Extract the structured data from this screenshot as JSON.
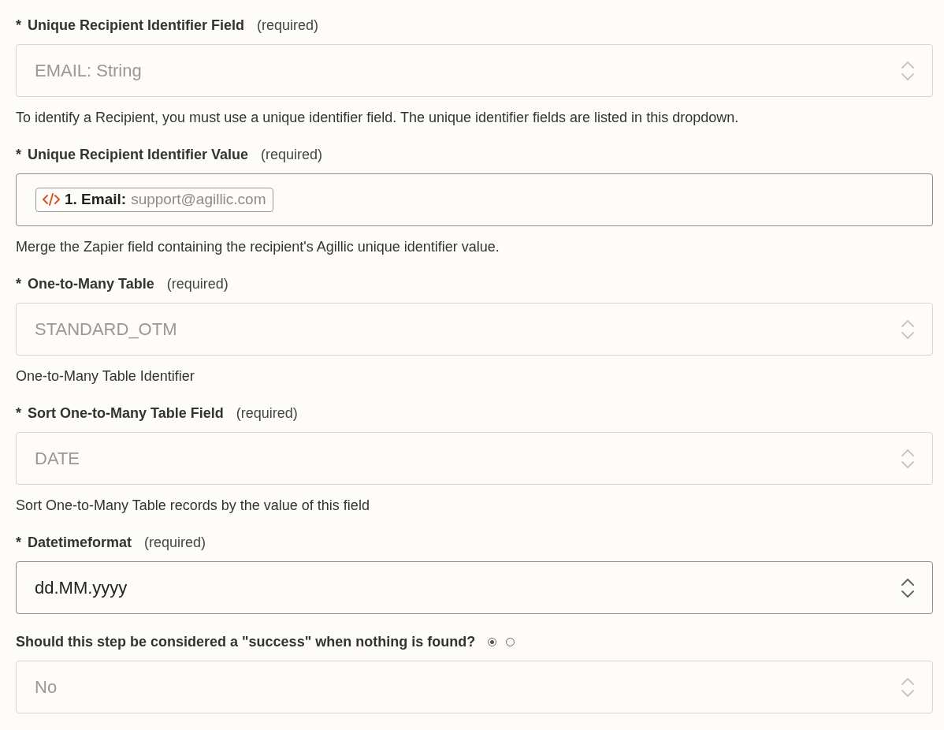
{
  "fields": [
    {
      "kind": "select",
      "asterisk": "*",
      "label": "Unique Recipient Identifier Field",
      "note": "(required)",
      "value": "EMAIL: String",
      "disabled": true,
      "help": "To identify a Recipient, you must use a unique identifier field. The unique identifier fields are listed in this dropdown."
    },
    {
      "kind": "token",
      "asterisk": "*",
      "label": "Unique Recipient Identifier Value",
      "note": "(required)",
      "token_label": "1. Email:",
      "token_value": "support@agillic.com",
      "help": "Merge the Zapier field containing the recipient's Agillic unique identifier value."
    },
    {
      "kind": "select",
      "asterisk": "*",
      "label": "One-to-Many Table",
      "note": "(required)",
      "value": "STANDARD_OTM",
      "disabled": true,
      "help": "One-to-Many Table Identifier"
    },
    {
      "kind": "select",
      "asterisk": "*",
      "label": "Sort One-to-Many Table Field",
      "note": "(required)",
      "value": "DATE",
      "disabled": true,
      "help": "Sort One-to-Many Table records by the value of this field"
    },
    {
      "kind": "select",
      "asterisk": "*",
      "label": "Datetimeformat",
      "note": "(required)",
      "value": "dd.MM.yyyy",
      "disabled": false
    },
    {
      "kind": "select",
      "label": "Should this step be considered a \"success\" when nothing is found?",
      "radios": [
        {
          "selected": true
        },
        {
          "selected": false
        }
      ],
      "value": "No",
      "disabled": true
    }
  ]
}
